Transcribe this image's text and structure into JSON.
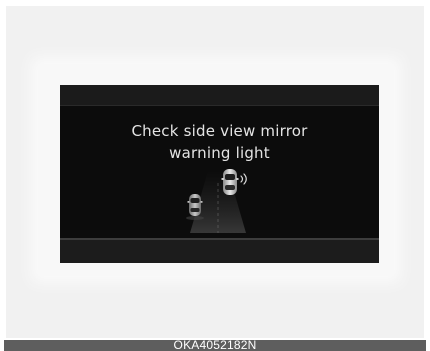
{
  "display": {
    "message_line1": "Check side view mirror",
    "message_line2": "warning light",
    "icon": "blind-spot-warning-icon"
  },
  "caption": {
    "code": "OKA4052182N"
  },
  "colors": {
    "display_background": "#0c0c0c",
    "message_text": "#e4e4e4",
    "caption_bar": "#5e5e5e"
  }
}
